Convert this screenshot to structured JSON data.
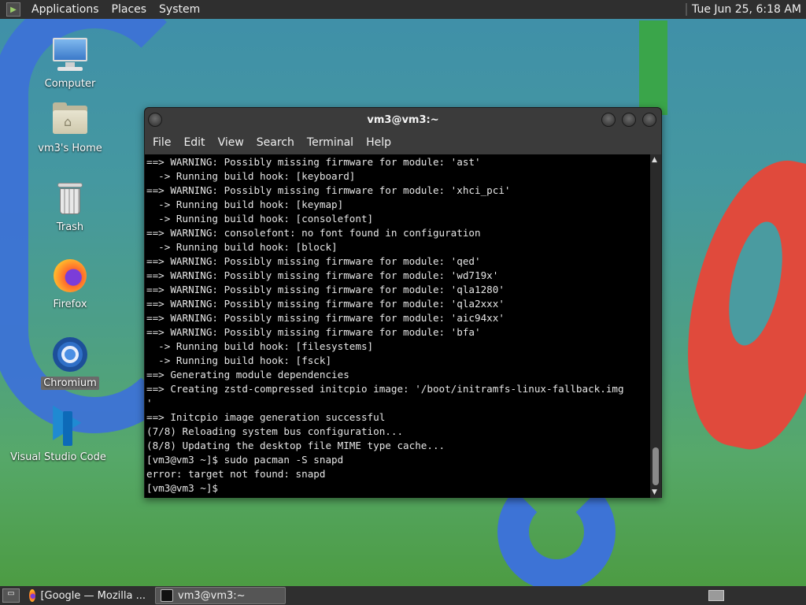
{
  "top_panel": {
    "menus": [
      "Applications",
      "Places",
      "System"
    ],
    "clock": "Tue Jun 25,  6:18 AM"
  },
  "desktop_icons": [
    {
      "label": "Computer",
      "icon": "computer-icon"
    },
    {
      "label": "vm3's Home",
      "icon": "home-folder-icon"
    },
    {
      "label": "Trash",
      "icon": "trash-icon"
    },
    {
      "label": "Firefox",
      "icon": "firefox-icon"
    },
    {
      "label": "Chromium",
      "icon": "chromium-icon",
      "selected": true
    },
    {
      "label": "Visual Studio Code",
      "icon": "vscode-icon"
    }
  ],
  "terminal": {
    "title": "vm3@vm3:~",
    "menu": [
      "File",
      "Edit",
      "View",
      "Search",
      "Terminal",
      "Help"
    ],
    "lines": [
      "==> WARNING: Possibly missing firmware for module: 'ast'",
      "  -> Running build hook: [keyboard]",
      "==> WARNING: Possibly missing firmware for module: 'xhci_pci'",
      "  -> Running build hook: [keymap]",
      "  -> Running build hook: [consolefont]",
      "==> WARNING: consolefont: no font found in configuration",
      "  -> Running build hook: [block]",
      "==> WARNING: Possibly missing firmware for module: 'qed'",
      "==> WARNING: Possibly missing firmware for module: 'wd719x'",
      "==> WARNING: Possibly missing firmware for module: 'qla1280'",
      "==> WARNING: Possibly missing firmware for module: 'qla2xxx'",
      "==> WARNING: Possibly missing firmware for module: 'aic94xx'",
      "==> WARNING: Possibly missing firmware for module: 'bfa'",
      "  -> Running build hook: [filesystems]",
      "  -> Running build hook: [fsck]",
      "==> Generating module dependencies",
      "==> Creating zstd-compressed initcpio image: '/boot/initramfs-linux-fallback.img",
      "'",
      "==> Initcpio image generation successful",
      "(7/8) Reloading system bus configuration...",
      "(8/8) Updating the desktop file MIME type cache...",
      "[vm3@vm3 ~]$ sudo pacman -S snapd",
      "error: target not found: snapd",
      "[vm3@vm3 ~]$ "
    ]
  },
  "taskbar": {
    "tasks": [
      {
        "label": "[Google — Mozilla ...",
        "icon": "firefox-icon",
        "active": false
      },
      {
        "label": "vm3@vm3:~",
        "icon": "terminal-icon",
        "active": true
      }
    ]
  }
}
